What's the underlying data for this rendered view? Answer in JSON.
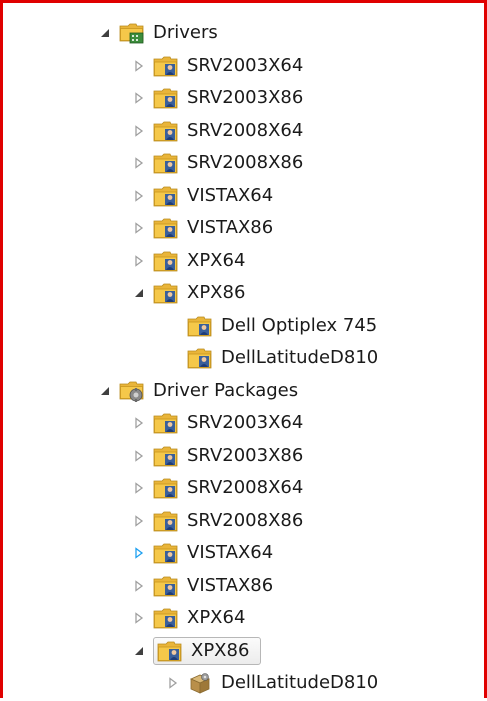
{
  "tree": {
    "groups": [
      {
        "label": "Drivers",
        "icon": "drivers-root-icon",
        "expanded": true,
        "children": [
          {
            "label": "SRV2003X64",
            "icon": "folder-icon",
            "expanded": false
          },
          {
            "label": "SRV2003X86",
            "icon": "folder-icon",
            "expanded": false
          },
          {
            "label": "SRV2008X64",
            "icon": "folder-icon",
            "expanded": false
          },
          {
            "label": "SRV2008X86",
            "icon": "folder-icon",
            "expanded": false
          },
          {
            "label": "VISTAX64",
            "icon": "folder-icon",
            "expanded": false
          },
          {
            "label": "VISTAX86",
            "icon": "folder-icon",
            "expanded": false
          },
          {
            "label": "XPX64",
            "icon": "folder-icon",
            "expanded": false
          },
          {
            "label": "XPX86",
            "icon": "folder-icon",
            "expanded": true,
            "children": [
              {
                "label": "Dell Optiplex 745",
                "icon": "folder-icon"
              },
              {
                "label": "DellLatitudeD810",
                "icon": "folder-icon"
              }
            ]
          }
        ]
      },
      {
        "label": "Driver Packages",
        "icon": "driver-packages-root-icon",
        "expanded": true,
        "children": [
          {
            "label": "SRV2003X64",
            "icon": "folder-icon",
            "expanded": false
          },
          {
            "label": "SRV2003X86",
            "icon": "folder-icon",
            "expanded": false
          },
          {
            "label": "SRV2008X64",
            "icon": "folder-icon",
            "expanded": false
          },
          {
            "label": "SRV2008X86",
            "icon": "folder-icon",
            "expanded": false
          },
          {
            "label": "VISTAX64",
            "icon": "folder-icon",
            "expanded": false,
            "hovered": true
          },
          {
            "label": "VISTAX86",
            "icon": "folder-icon",
            "expanded": false
          },
          {
            "label": "XPX64",
            "icon": "folder-icon",
            "expanded": false
          },
          {
            "label": "XPX86",
            "icon": "folder-icon",
            "expanded": true,
            "selected": true,
            "children": [
              {
                "label": "DellLatitudeD810",
                "icon": "package-icon",
                "expanded": false
              }
            ]
          }
        ]
      }
    ]
  },
  "colors": {
    "frame_border": "#e00000",
    "expander_collapsed": "#a0a0a0",
    "expander_hover": "#1ea0f0",
    "expander_expanded": "#404040",
    "folder_yellow": "#f5c84a",
    "selection_border": "#b7b7b7"
  }
}
